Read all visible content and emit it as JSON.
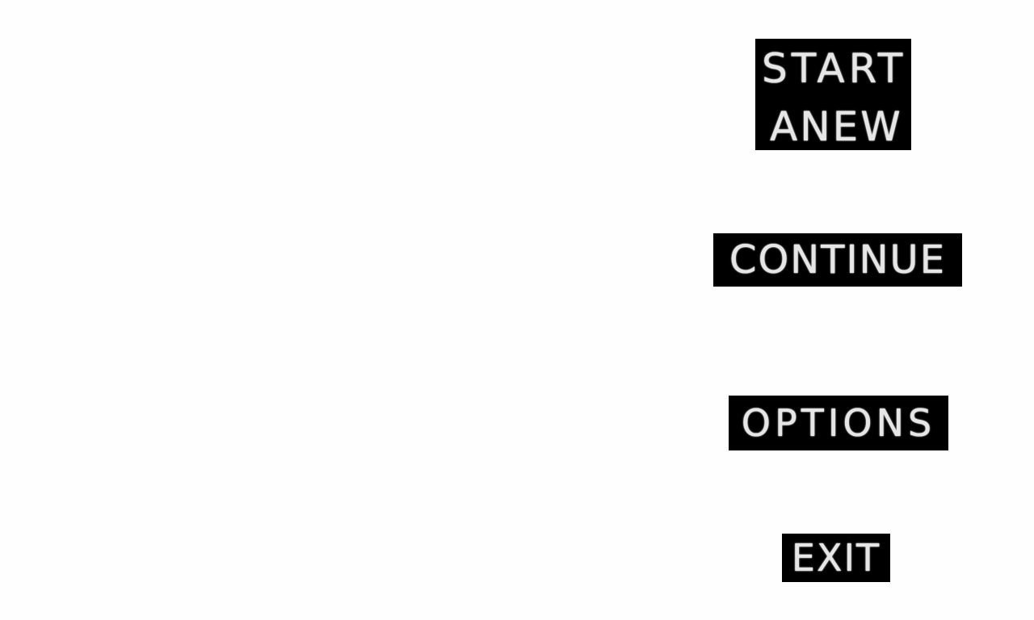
{
  "menu": {
    "start_line1": "START",
    "start_line2": "ANEW",
    "continue": "CONTINUE",
    "options": "OPTIONS",
    "exit": "EXIT"
  },
  "colors": {
    "background": "#fefefe",
    "button_background": "#000000",
    "button_text": "#e6e6e6"
  }
}
